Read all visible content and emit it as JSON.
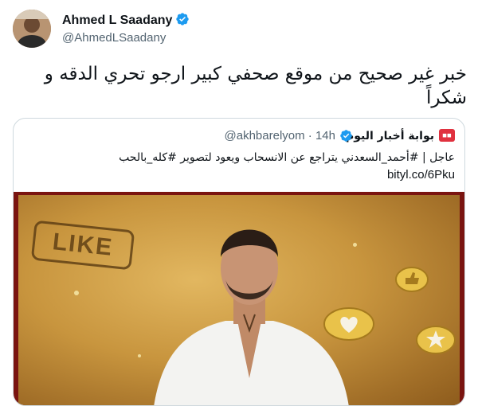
{
  "tweet": {
    "author": {
      "display_name": "Ahmed L Saadany",
      "handle": "@AhmedLSaadany",
      "verified": true,
      "verified_icon": "verified-badge-icon"
    },
    "text": "خبر غير صحيح من موقع صحفي كبير ارجو تحري الدقه و شكراً",
    "quote": {
      "name": "بوابة أخبار اليوم",
      "handle": "@akhbarelyom",
      "time": "14h",
      "separator": "·",
      "text": "عاجل | #أحمد_السعدني يتراجع عن الانسحاب ويعود لتصوير #كله_بالحب",
      "link": "bityl.co/6Pku",
      "logo_icon": "akhbar-elyom-logo-icon",
      "media": {
        "overlay_text": "LIKE",
        "icons": [
          "heart-bubble-icon",
          "star-bubble-icon",
          "thumbs-up-bubble-icon"
        ]
      }
    }
  },
  "colors": {
    "verified": "#1d9bf0",
    "border": "#cfd9de",
    "secondary_text": "#536471",
    "primary_text": "#0f1419"
  }
}
